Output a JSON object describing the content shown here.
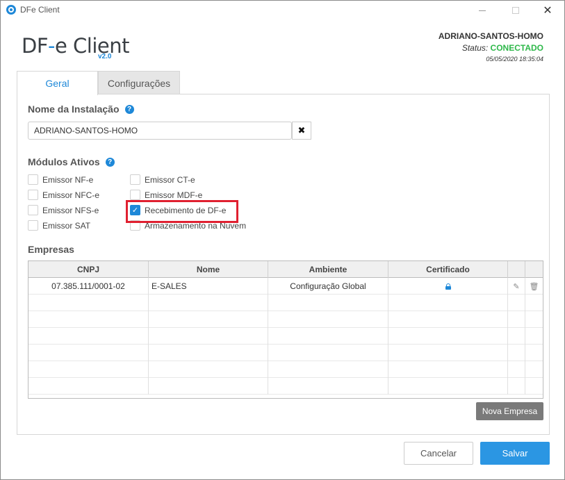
{
  "window": {
    "title": "DFe Client",
    "close_glyph": "✕"
  },
  "logo": {
    "text_df": "DF",
    "text_dot": "-",
    "text_rest": "e Client",
    "version": "v2.0"
  },
  "status": {
    "user": "ADRIANO-SANTOS-HOMO",
    "label": "Status:",
    "value": "CONECTADO",
    "datetime": "05/05/2020 18:35:04"
  },
  "tabs": [
    {
      "label": "Geral"
    },
    {
      "label": "Configurações"
    }
  ],
  "installation": {
    "label": "Nome da Instalação",
    "help": "?",
    "value": "ADRIANO-SANTOS-HOMO",
    "clear_glyph": "✖"
  },
  "modules": {
    "label": "Módulos Ativos",
    "help": "?",
    "left": [
      {
        "label": "Emissor NF-e",
        "checked": false
      },
      {
        "label": "Emissor NFC-e",
        "checked": false
      },
      {
        "label": "Emissor NFS-e",
        "checked": false
      },
      {
        "label": "Emissor SAT",
        "checked": false
      }
    ],
    "right": [
      {
        "label": "Emissor CT-e",
        "checked": false
      },
      {
        "label": "Emissor MDF-e",
        "checked": false
      },
      {
        "label": "Recebimento de DF-e",
        "checked": true
      },
      {
        "label": "Armazenamento na Nuvem",
        "checked": false
      }
    ],
    "check_glyph": "✓"
  },
  "companies": {
    "label": "Empresas",
    "columns": [
      "CNPJ",
      "Nome",
      "Ambiente",
      "Certificado"
    ],
    "rows": [
      {
        "cnpj": "07.385.111/0001-02",
        "nome": "E-SALES",
        "ambiente": "Configuração Global",
        "certificado": "lock-icon"
      }
    ],
    "edit_glyph": "✎",
    "delete_glyph": "🗑",
    "new_button": "Nova Empresa"
  },
  "footer": {
    "cancel": "Cancelar",
    "save": "Salvar"
  },
  "colors": {
    "accent": "#1e88d8",
    "connected": "#2eb84a",
    "highlight": "#e02030"
  }
}
